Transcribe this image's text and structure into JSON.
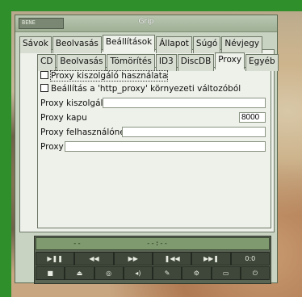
{
  "window": {
    "title": "Grip",
    "wm_button": "BENE"
  },
  "main_tabs": [
    {
      "label": "Sávok",
      "active": false
    },
    {
      "label": "Beolvasás",
      "active": false
    },
    {
      "label": "Beállítások",
      "active": true
    },
    {
      "label": "Állapot",
      "active": false
    },
    {
      "label": "Súgó",
      "active": false
    },
    {
      "label": "Névjegy",
      "active": false
    }
  ],
  "sub_tabs": [
    {
      "label": "CD",
      "active": false
    },
    {
      "label": "Beolvasás",
      "active": false
    },
    {
      "label": "Tömörítés",
      "active": false
    },
    {
      "label": "ID3",
      "active": false
    },
    {
      "label": "DiscDB",
      "active": false
    },
    {
      "label": "Proxy",
      "active": true
    },
    {
      "label": "Egyéb",
      "active": false
    }
  ],
  "proxy": {
    "use_proxy_label": "Proxy kiszolgáló használata",
    "use_env_label": "Beállítás a 'http_proxy' környezeti változóból",
    "server_label": "Proxy kiszolgáló",
    "server_value": "",
    "port_label": "Proxy kapu",
    "port_value": "8000",
    "user_label": "Proxy felhasználónév",
    "user_value": "",
    "password_label": "Proxy jelszó",
    "password_value": ""
  },
  "player": {
    "track_display": "--",
    "time_display": "--:--",
    "volume_label": "0:0",
    "buttons_row1": [
      "play-pause-icon",
      "rewind-icon",
      "fast-forward-icon",
      "previous-track-icon",
      "next-track-icon",
      "volume-label"
    ],
    "buttons_row2": [
      "stop-icon",
      "eject-icon",
      "shuffle-icon",
      "volume-icon",
      "edit-icon",
      "settings-icon",
      "window-icon",
      "power-icon"
    ]
  }
}
